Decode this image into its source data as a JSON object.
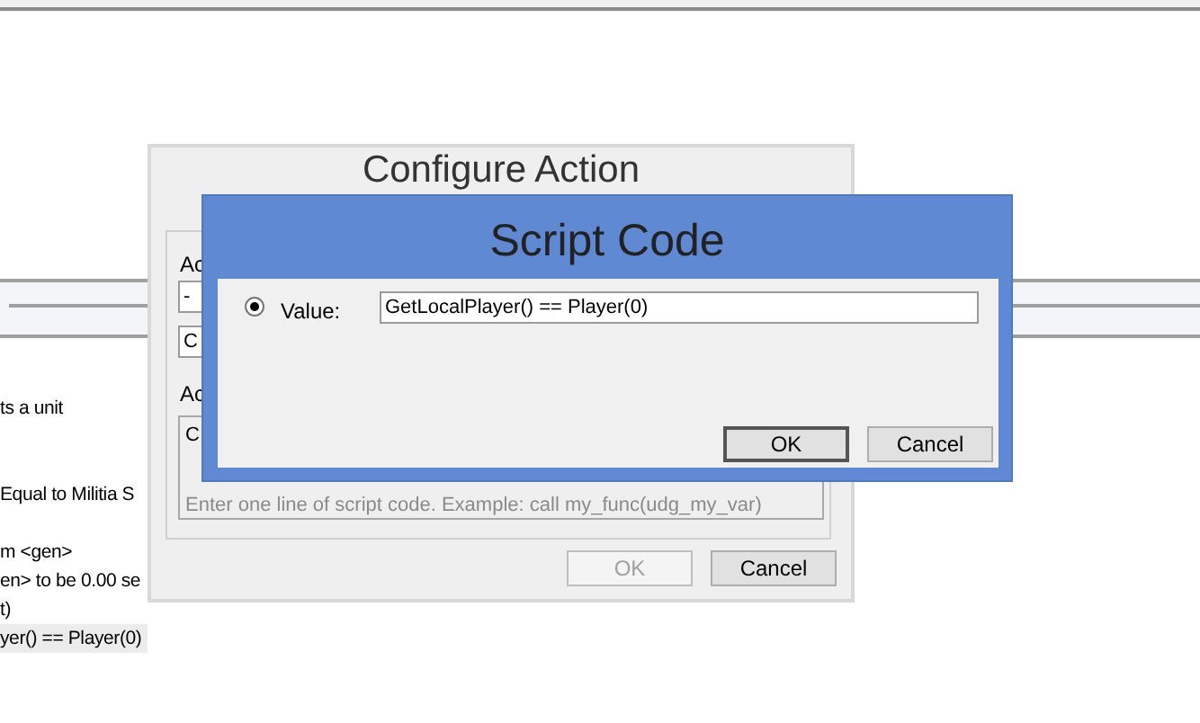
{
  "background_window": {
    "lines": [
      {
        "text": "ts a unit",
        "selected": false
      },
      {
        "text": "Equal to Militia S",
        "selected": false
      },
      {
        "text": "m <gen>",
        "selected": false
      },
      {
        "text": "en> to be 0.00 se",
        "selected": false
      },
      {
        "text": "t)",
        "selected": false
      },
      {
        "text": "yer() == Player(0)",
        "selected": true
      }
    ]
  },
  "configure_action": {
    "title": "Configure Action",
    "label_1": "Ac",
    "dropdown": "-",
    "field": "C",
    "label_2": "Ac",
    "text_area_value": "C",
    "placeholder": "Enter one line of script code.  Example:  call my_func(udg_my_var)",
    "buttons": [
      {
        "label": "OK",
        "disabled": true
      },
      {
        "label": "Cancel",
        "disabled": false
      }
    ]
  },
  "script_code": {
    "title": "Script Code",
    "option": {
      "label": "Value:",
      "selected": true
    },
    "value": "GetLocalPlayer() == Player(0)",
    "buttons": [
      {
        "label": "OK",
        "default": true
      },
      {
        "label": "Cancel",
        "default": false
      }
    ]
  }
}
